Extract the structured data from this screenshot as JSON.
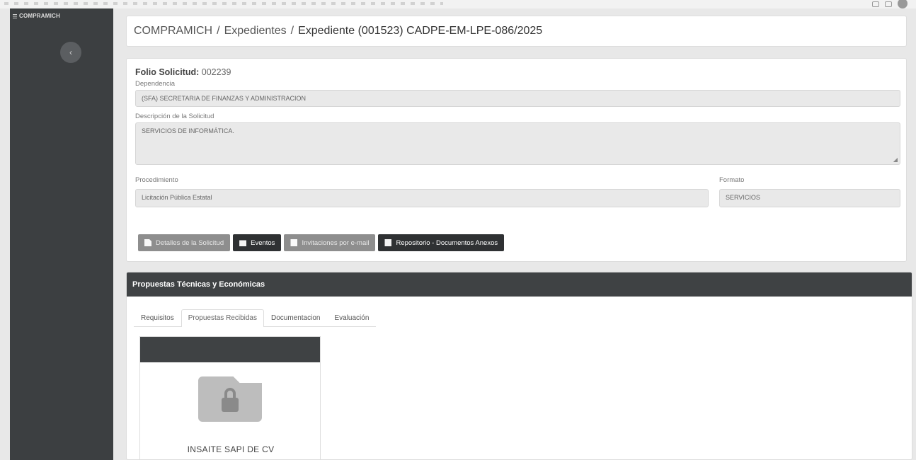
{
  "app": {
    "brand": "COMPRAMICH"
  },
  "breadcrumb": {
    "root": "COMPRAMICH",
    "section": "Expedientes",
    "current": "Expediente (001523) CADPE-EM-LPE-086/2025",
    "separator": "/"
  },
  "solicitud": {
    "folio_label": "Folio Solicitud:",
    "folio_value": "002239",
    "dependencia_label": "Dependencia",
    "dependencia_value": "(SFA) SECRETARIA DE FINANZAS Y ADMINISTRACION",
    "descripcion_label": "Descripción de la Solicitud",
    "descripcion_value": "SERVICIOS DE INFORMÁTICA.",
    "procedimiento_label": "Procedimiento",
    "procedimiento_value": "Licitación Pública Estatal",
    "formato_label": "Formato",
    "formato_value": "SERVICIOS"
  },
  "actions": {
    "detalles": "Detalles de la Solicitud",
    "eventos": "Eventos",
    "invitaciones": "Invitaciones por e-mail",
    "repositorio": "Repositorio - Documentos Anexos"
  },
  "propuestas": {
    "header": "Propuestas Técnicas y Económicas",
    "tabs": [
      {
        "label": "Requisitos"
      },
      {
        "label": "Propuestas Recibidas"
      },
      {
        "label": "Documentacion"
      },
      {
        "label": "Evaluación"
      }
    ],
    "active_tab": "Propuestas Recibidas",
    "vendor": {
      "name": "INSAITE SAPI DE CV",
      "icon": "locked-folder-icon"
    }
  },
  "colors": {
    "sidebar": "#3c3f41",
    "panel_header": "#3f4244",
    "button_dark": "#2f3133",
    "button_light": "#8e8e8e"
  }
}
